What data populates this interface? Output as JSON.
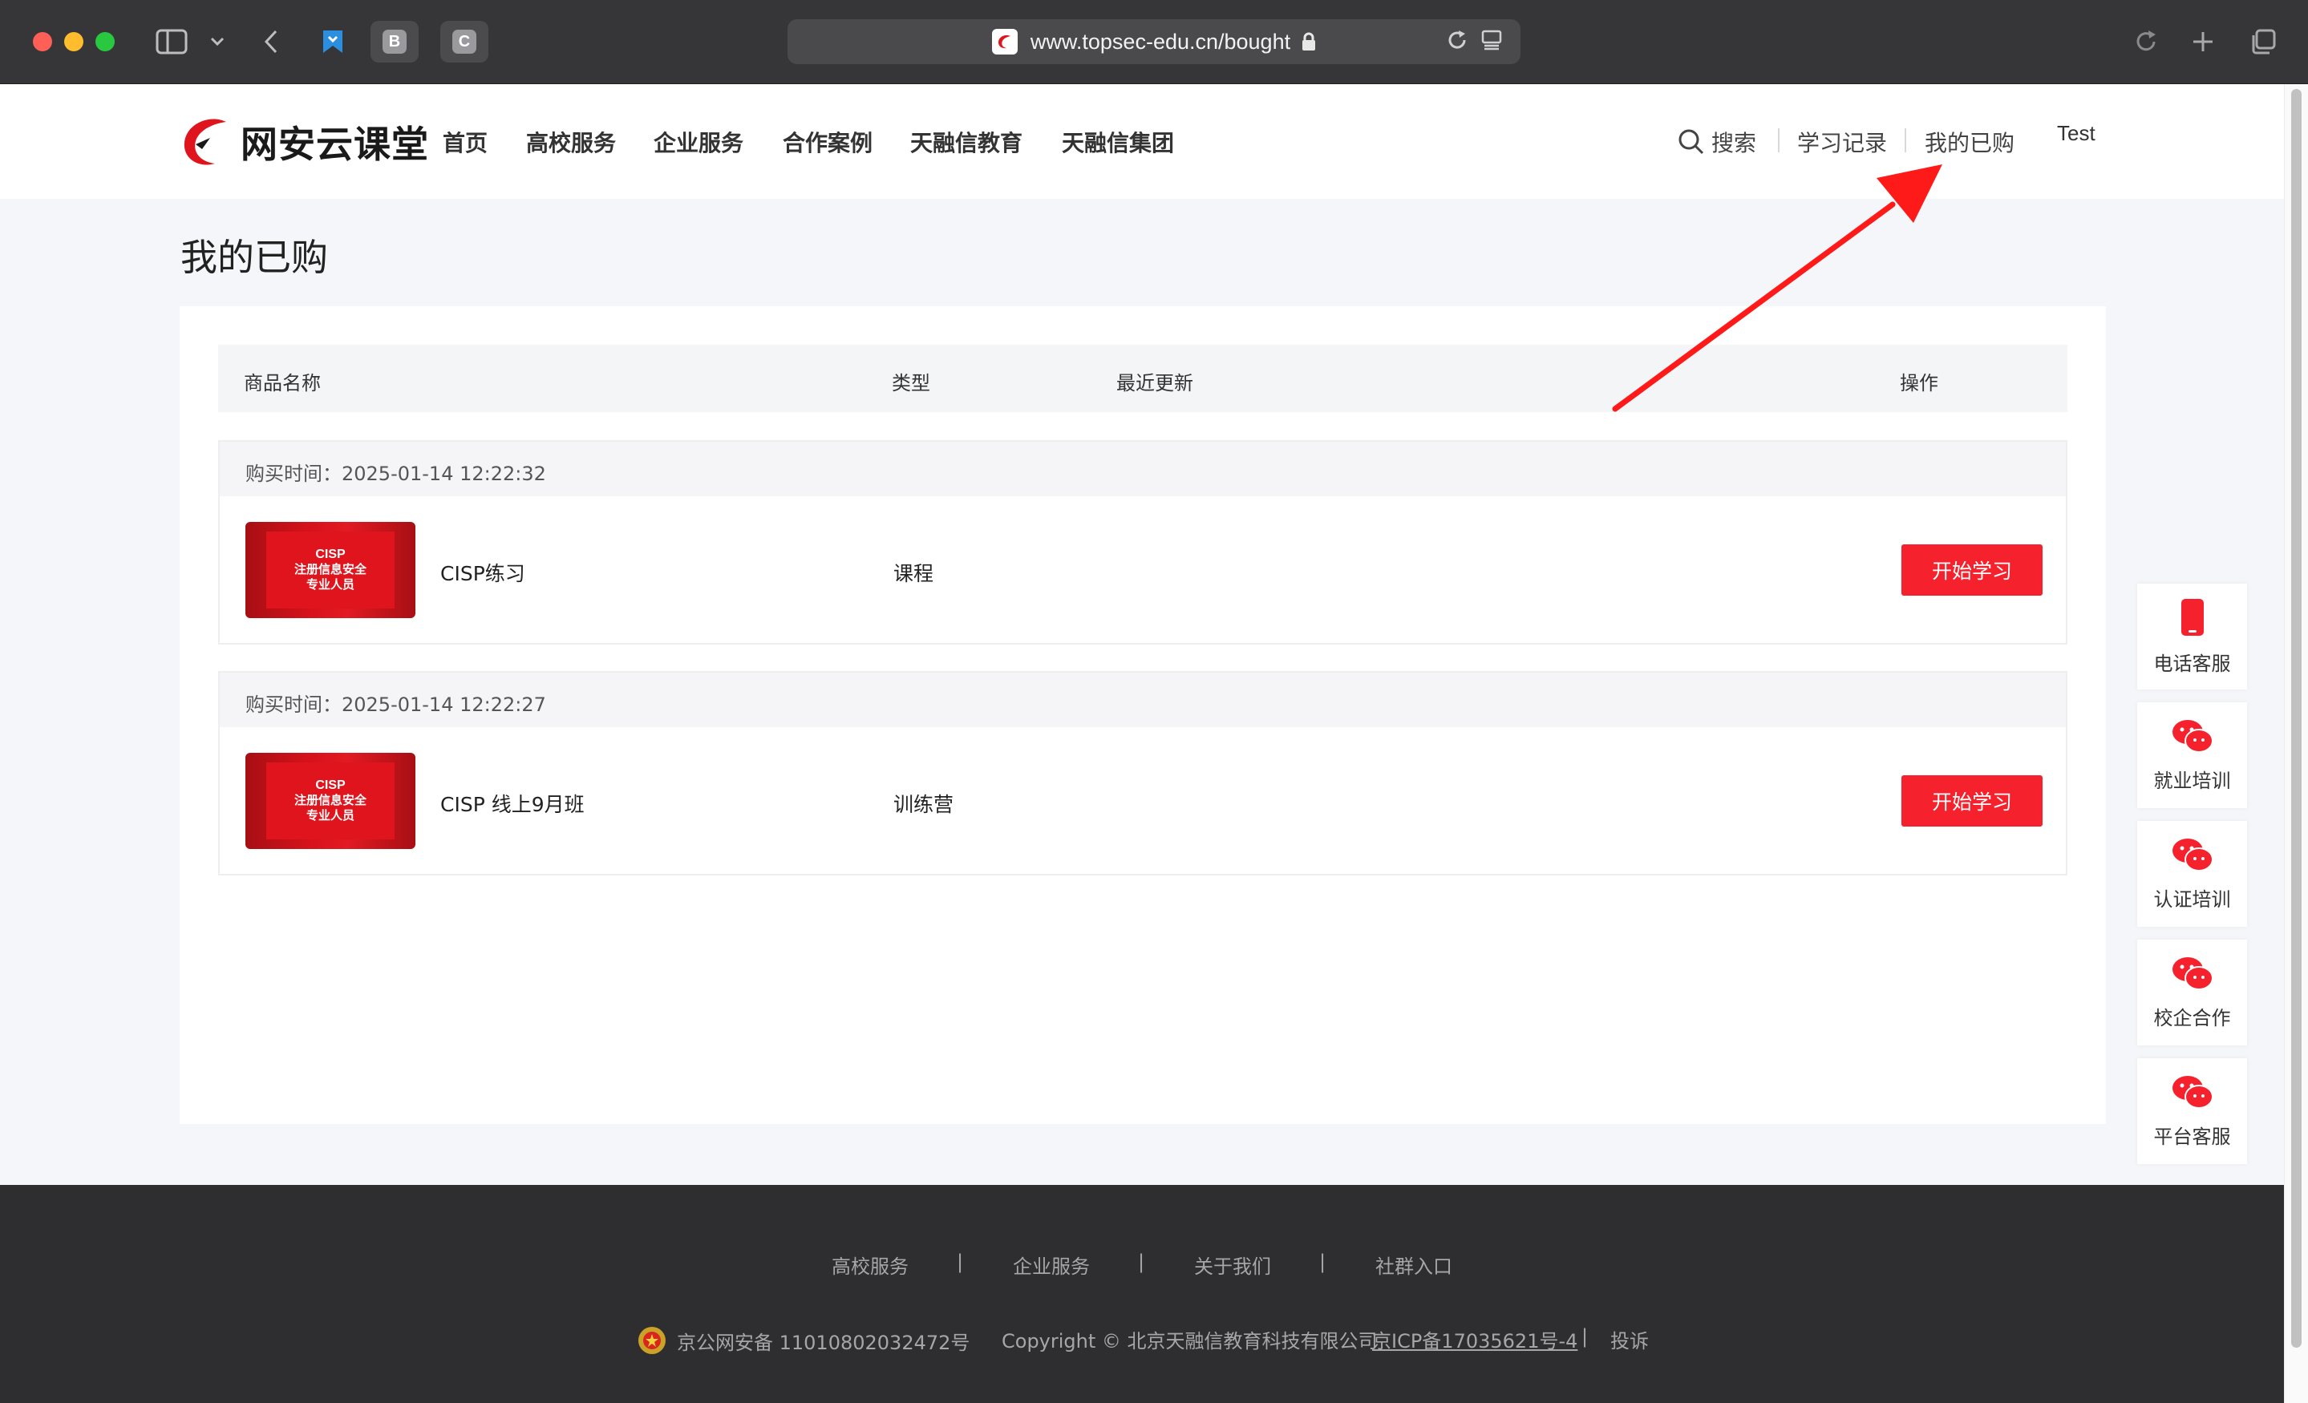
{
  "browser": {
    "url": "www.topsec-edu.cn/bought",
    "tabs": [
      {
        "icon": "bookmark-icon",
        "label": ""
      },
      {
        "icon": "letter-tab-icon",
        "label": "B"
      },
      {
        "icon": "letter-tab-icon",
        "label": "C"
      }
    ]
  },
  "nav": {
    "logo_text": "网安云课堂",
    "items": [
      "首页",
      "高校服务",
      "企业服务",
      "合作案例",
      "天融信教育",
      "天融信集团"
    ],
    "search_label": "搜索",
    "study_record": "学习记录",
    "my_purchased": "我的已购",
    "user": "Test"
  },
  "page": {
    "title": "我的已购",
    "columns": [
      "商品名称",
      "类型",
      "最近更新",
      "操作"
    ],
    "orders": [
      {
        "time_label": "购买时间：2025-01-14 12:22:32",
        "name": "CISP练习",
        "type": "课程",
        "action": "开始学习",
        "thumb": {
          "title": "CISP",
          "line1": "注册信息安全",
          "line2": "专业人员"
        }
      },
      {
        "time_label": "购买时间：2025-01-14 12:22:27",
        "name": "CISP 线上9月班",
        "type": "训练营",
        "action": "开始学习",
        "thumb": {
          "title": "CISP",
          "line1": "注册信息安全",
          "line2": "专业人员"
        }
      }
    ]
  },
  "side_panel": [
    {
      "icon": "phone-icon",
      "label": "电话客服"
    },
    {
      "icon": "wechat-icon",
      "label": "就业培训"
    },
    {
      "icon": "wechat-icon",
      "label": "认证培训"
    },
    {
      "icon": "wechat-icon",
      "label": "校企合作"
    },
    {
      "icon": "wechat-icon",
      "label": "平台客服"
    }
  ],
  "footer": {
    "links": [
      "高校服务",
      "企业服务",
      "关于我们",
      "社群入口"
    ],
    "separator": "|",
    "police_record": "京公网安备 11010802032472号",
    "copyright": "Copyright © 北京天融信教育科技有限公司",
    "icp": "京ICP备17035621号-4",
    "complaint": "投诉"
  },
  "colors": {
    "accent": "#f5222d",
    "annotation_arrow": "#ff1a1a",
    "footer_bg": "#2e2e30",
    "page_bg": "#f4f6f9"
  }
}
